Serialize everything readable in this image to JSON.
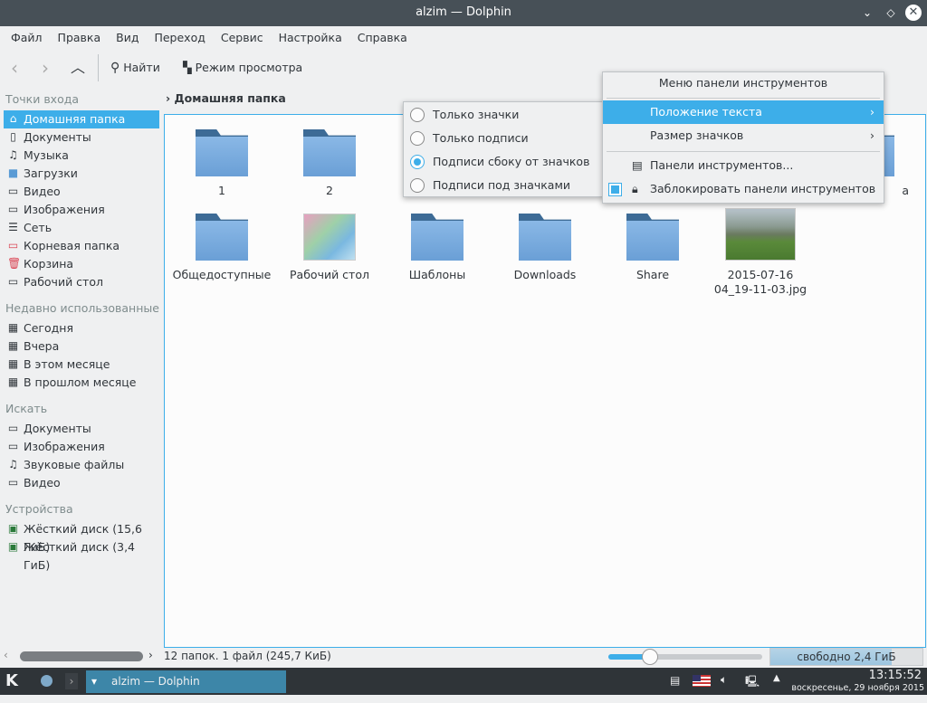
{
  "window": {
    "title": "alzim — Dolphin"
  },
  "menubar": [
    "Файл",
    "Правка",
    "Вид",
    "Переход",
    "Сервис",
    "Настройка",
    "Справка"
  ],
  "toolbar": {
    "find": "Найти",
    "view_mode": "Режим просмотра"
  },
  "breadcrumb": "Домашняя папка",
  "sidebar": {
    "places_header": "Точки входа",
    "places": [
      "Домашняя папка",
      "Документы",
      "Музыка",
      "Загрузки",
      "Видео",
      "Изображения",
      "Сеть",
      "Корневая папка",
      "Корзина",
      "Рабочий стол"
    ],
    "recent_header": "Недавно использованные",
    "recent": [
      "Сегодня",
      "Вчера",
      "В этом месяце",
      "В прошлом месяце"
    ],
    "search_header": "Искать",
    "search": [
      "Документы",
      "Изображения",
      "Звуковые файлы",
      "Видео"
    ],
    "devices_header": "Устройства",
    "devices": [
      "Жёсткий диск (15,6 ГиБ)",
      "Жёсткий диск (3,4 ГиБ)"
    ]
  },
  "files": {
    "row1": [
      "1",
      "2",
      "а"
    ],
    "row2": [
      "Общедоступные",
      "Рабочий стол",
      "Шаблоны",
      "Downloads",
      "Share",
      "2015-07-16 04_19-11-03.jpg"
    ]
  },
  "context_menu": {
    "title": "Меню панели инструментов",
    "items": [
      "Положение текста",
      "Размер значков",
      "Панели инструментов...",
      "Заблокировать панели инструментов"
    ],
    "lock_checked": true
  },
  "submenu": {
    "options": [
      "Только значки",
      "Только подписи",
      "Подписи сбоку от значков",
      "Подписи под значками"
    ],
    "selected": 2
  },
  "status": {
    "text": "12 папок. 1 файл (245,7 КиБ)",
    "free": "свободно 2,4 ГиБ",
    "zoom_fraction": 0.27,
    "disk_used_fraction": 0.8
  },
  "taskbar": {
    "task": "alzim — Dolphin",
    "time": "13:15:52",
    "date": "воскресенье, 29 ноября 2015 г."
  },
  "colors": {
    "accent": "#3daee9",
    "titlebar": "#475057",
    "taskbar": "#2f3438"
  }
}
